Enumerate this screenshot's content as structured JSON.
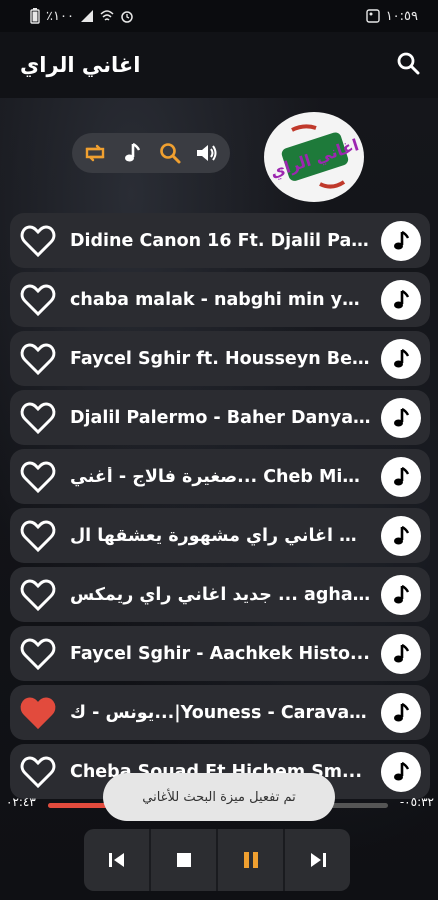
{
  "status_bar": {
    "battery": "٪١٠٠",
    "time": "١٠:٥٩"
  },
  "app_bar": {
    "title": "اغاني الراي",
    "search_icon": "search-icon"
  },
  "controls": [
    "repeat-icon",
    "music-note-icon",
    "search-icon",
    "volume-icon"
  ],
  "logo_text": "اغاني الراي",
  "colors": {
    "row_bg": "#2b2c31",
    "accent_red": "#e24b3d",
    "controls_active": "#f0a030"
  },
  "songs": [
    {
      "title": "Didine Canon 16 Ft. Djalil Pal...",
      "favorite": false
    },
    {
      "title": "chaba malak - nabghi min ye...",
      "favorite": false
    },
    {
      "title": "Faycel Sghir ft. Housseyn Be...",
      "favorite": false
    },
    {
      "title": "Djalil Palermo - Baher Danya...",
      "favorite": false
    },
    {
      "title": "صغيرة فالاج - أغني... Cheb Midou",
      "favorite": false
    },
    {
      "title": "اجمل اغاني راي مشهورة يعشقها ال...",
      "favorite": false
    },
    {
      "title": "جديد اغاني راي ريمكس ... aghani r",
      "favorite": false
    },
    {
      "title": "Faycel Sghir - Aachkek Histo...",
      "favorite": false
    },
    {
      "title": "يونس - ك...|Youness - Caravane",
      "favorite": true
    },
    {
      "title": "Cheba Souad Ft Hichem Sm...",
      "favorite": false
    }
  ],
  "toast": "تم تفعيل ميزة البحث للأغاني",
  "player": {
    "elapsed": "٠٢:٤٣",
    "remaining": "-٠٥:٣٢",
    "progress": 0.49
  }
}
